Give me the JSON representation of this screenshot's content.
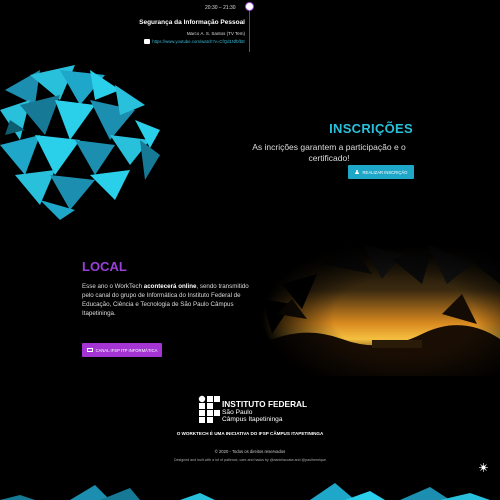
{
  "schedule": {
    "time": "20:30 – 21:30",
    "title": "Segurança da Informação Pessoal",
    "speaker": "Marco A. S. Santos (TV Tem)",
    "link": "https://www.youtube.com/watch?v=CfQd1NfbfbE"
  },
  "inscricoes": {
    "title": "INSCRIÇÕES",
    "text": "As incrições garantem a participação e o certificado!",
    "button_label": "REALIZAR INSCRIÇÃO",
    "accent": "#29c0dc"
  },
  "local": {
    "title": "LOCAL",
    "text_pre": "Esse ano o WorkTech ",
    "text_bold": "acontecerá online",
    "text_post": ", sendo transmitido pelo canal do grupo de Informática do Instituto Federal de Educação, Ciência e Tecnologia de São Paulo Câmpus Itapetininga.",
    "button_label": "CANAL IFSP ITP INFORMÁTICA",
    "accent": "#9b3fd9"
  },
  "footer": {
    "institution_name": "INSTITUTO FEDERAL",
    "institution_state": "São Paulo",
    "institution_campus": "Câmpus Itapetininga",
    "note": "O WORKTECH É UMA INICIATIVA DO IFSP CÂMPUS ITAPETININGA",
    "copyright": "© 2020 - Todos os direitos reservados",
    "credits": "Designed and built with a lot of patience, care and hacks by @danielacosta and @paulhenrique"
  }
}
